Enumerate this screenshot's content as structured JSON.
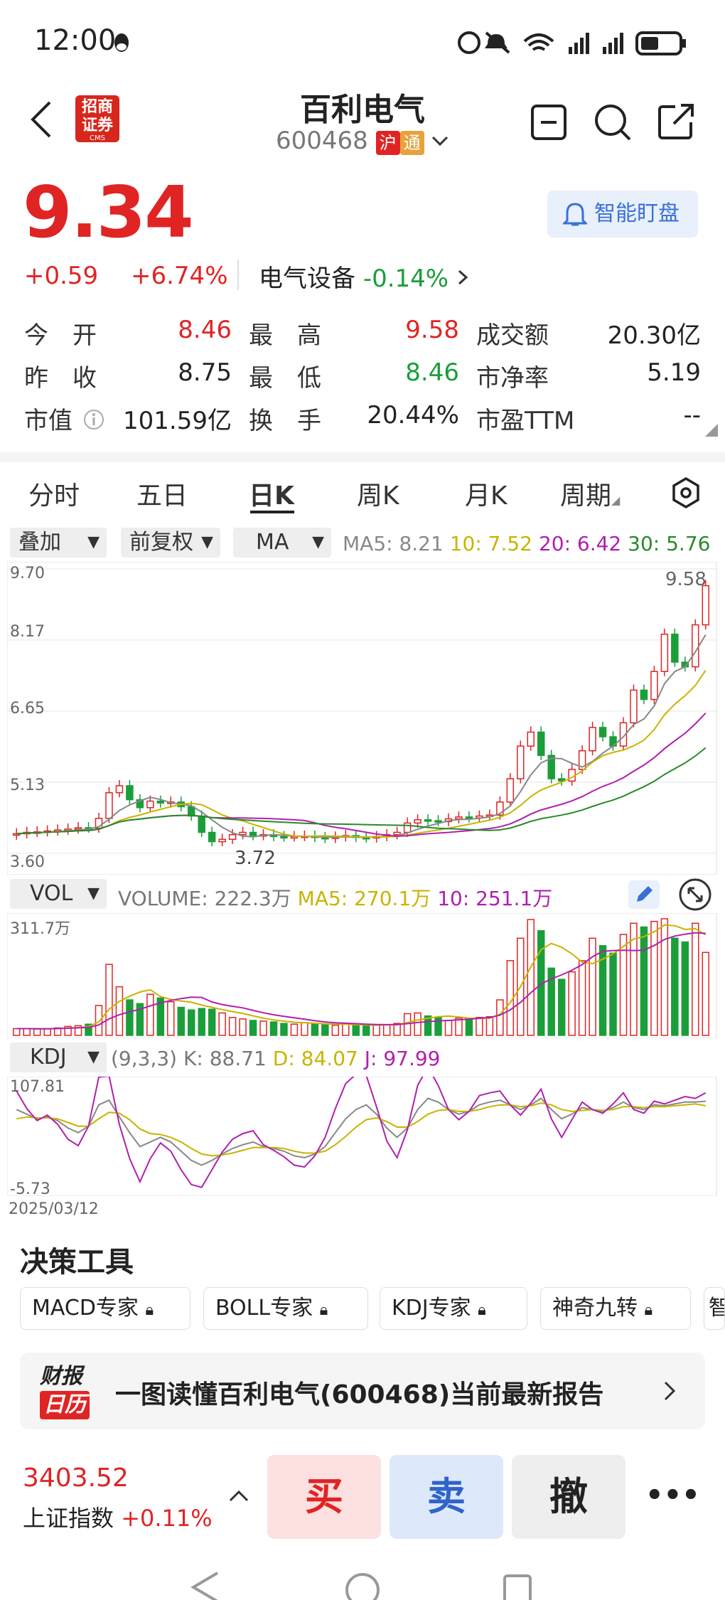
{
  "status_bar": {
    "time": "12:00"
  },
  "header": {
    "title": "百利电气",
    "code": "600468",
    "badge_sh": "沪",
    "badge_tong": "通",
    "broker_logo": "招商证券",
    "broker_logo_en": "CMS"
  },
  "quote": {
    "price": "9.34",
    "change": "+0.59",
    "change_pct": "+6.74%",
    "sector_name": "电气设备",
    "sector_chg": "-0.14%",
    "smart_watch": "智能盯盘"
  },
  "stats": {
    "open_label": "今　开",
    "open": "8.46",
    "high_label": "最　高",
    "high": "9.58",
    "turnover_amt_label": "成交额",
    "turnover_amt": "20.30亿",
    "prev_label": "昨　收",
    "prev": "8.75",
    "low_label": "最　低",
    "low": "8.46",
    "pb_label": "市净率",
    "pb": "5.19",
    "mcap_label": "市值",
    "mcap": "101.59亿",
    "turnover_rate_label": "换　手",
    "turnover_rate": "20.44%",
    "pe_label": "市盈TTM",
    "pe": "--"
  },
  "tabs": [
    "分时",
    "五日",
    "日K",
    "周K",
    "月K",
    "周期"
  ],
  "selectors": {
    "overlay": "叠加",
    "adjust": "前复权",
    "indicator": "MA"
  },
  "ma_legend": {
    "ma5": "MA5: 8.21",
    "ma10": "10: 7.52",
    "ma20": "20: 6.42",
    "ma30": "30: 5.76"
  },
  "vol_legend": {
    "selector": "VOL",
    "volume": "VOLUME: 222.3万",
    "ma5": "MA5: 270.1万",
    "ma10": "10: 251.1万"
  },
  "kdj_legend": {
    "selector": "KDJ",
    "params": "(9,3,3) K: 88.71",
    "d": "D: 84.07",
    "j": "J: 97.99"
  },
  "chart_data": {
    "type": "candlestick",
    "y_ticks": [
      "9.70",
      "8.17",
      "6.65",
      "5.13",
      "3.60"
    ],
    "ylim": [
      3.6,
      9.7
    ],
    "max_label": "9.58",
    "min_label": "3.72",
    "vol_max_label": "311.7万",
    "kdj_ticks": [
      "107.81",
      "-5.73"
    ],
    "start_date": "2025/03/12",
    "closes": [
      4.02,
      4.05,
      4.06,
      4.08,
      4.1,
      4.12,
      4.15,
      4.14,
      4.35,
      4.9,
      5.05,
      4.75,
      4.58,
      4.72,
      4.68,
      4.7,
      4.6,
      4.4,
      4.05,
      3.85,
      3.9,
      4.0,
      4.05,
      3.98,
      4.0,
      3.96,
      3.95,
      3.96,
      3.97,
      3.94,
      3.92,
      3.95,
      3.98,
      3.94,
      3.93,
      3.96,
      4.0,
      4.05,
      4.25,
      4.32,
      4.3,
      4.28,
      4.34,
      4.38,
      4.36,
      4.4,
      4.42,
      4.7,
      5.2,
      5.9,
      6.2,
      5.7,
      5.2,
      5.15,
      5.4,
      5.8,
      6.3,
      6.1,
      5.9,
      6.4,
      7.1,
      6.9,
      7.5,
      8.3,
      7.7,
      7.6,
      8.5,
      9.34
    ],
    "volumes": [
      18,
      18,
      17,
      18,
      20,
      24,
      26,
      30,
      80,
      190,
      130,
      95,
      85,
      110,
      100,
      90,
      75,
      68,
      72,
      70,
      60,
      48,
      44,
      40,
      38,
      36,
      32,
      30,
      34,
      30,
      28,
      27,
      30,
      28,
      26,
      27,
      28,
      32,
      58,
      60,
      52,
      48,
      40,
      46,
      44,
      48,
      50,
      95,
      200,
      260,
      310,
      280,
      180,
      150,
      170,
      200,
      260,
      240,
      220,
      270,
      300,
      290,
      305,
      312,
      260,
      250,
      300,
      222
    ],
    "kdj_k": [
      80,
      75,
      70,
      72,
      68,
      60,
      55,
      62,
      85,
      90,
      72,
      55,
      40,
      45,
      50,
      45,
      35,
      25,
      20,
      25,
      32,
      38,
      42,
      45,
      40,
      38,
      35,
      30,
      28,
      32,
      40,
      55,
      70,
      80,
      85,
      75,
      60,
      50,
      60,
      80,
      92,
      88,
      80,
      75,
      78,
      85,
      88,
      90,
      85,
      80,
      85,
      92,
      80,
      70,
      75,
      82,
      80,
      78,
      82,
      88,
      82,
      80,
      85,
      84,
      86,
      88,
      88,
      89
    ],
    "kdj_d": [
      70,
      72,
      71,
      71,
      70,
      66,
      62,
      62,
      70,
      77,
      76,
      69,
      59,
      54,
      53,
      50,
      45,
      38,
      32,
      30,
      31,
      33,
      36,
      39,
      39,
      39,
      38,
      35,
      33,
      33,
      35,
      42,
      51,
      61,
      69,
      71,
      67,
      61,
      61,
      67,
      75,
      79,
      80,
      78,
      78,
      80,
      83,
      85,
      85,
      83,
      84,
      87,
      85,
      80,
      78,
      79,
      80,
      79,
      80,
      83,
      83,
      82,
      83,
      83,
      84,
      85,
      86,
      84
    ],
    "kdj_j": [
      100,
      81,
      68,
      74,
      64,
      48,
      41,
      62,
      115,
      116,
      64,
      27,
      2,
      27,
      44,
      35,
      15,
      -1,
      -4,
      15,
      34,
      48,
      54,
      57,
      42,
      36,
      29,
      20,
      18,
      30,
      50,
      81,
      108,
      118,
      117,
      83,
      46,
      28,
      58,
      106,
      126,
      106,
      80,
      69,
      78,
      95,
      98,
      100,
      85,
      74,
      87,
      102,
      70,
      50,
      69,
      88,
      80,
      76,
      86,
      98,
      80,
      76,
      89,
      86,
      90,
      94,
      92,
      98
    ]
  },
  "decision": {
    "title": "决策工具",
    "tools": [
      "MACD专家",
      "BOLL专家",
      "KDJ专家",
      "神奇九转",
      "智"
    ]
  },
  "report": {
    "logo1": "财报",
    "logo2": "日历",
    "text": "一图读懂百利电气(600468)当前最新报告"
  },
  "bottom": {
    "index_value": "3403.52",
    "index_name": "上证指数",
    "index_chg": "+0.11%",
    "buy": "买",
    "sell": "卖",
    "cancel": "撤",
    "more": "•••"
  },
  "colors": {
    "up": "#e02424",
    "down": "#1a9e3a",
    "ma5": "#888888",
    "ma10": "#c8b400",
    "ma20": "#b020b0",
    "ma30": "#2a8a2a"
  }
}
